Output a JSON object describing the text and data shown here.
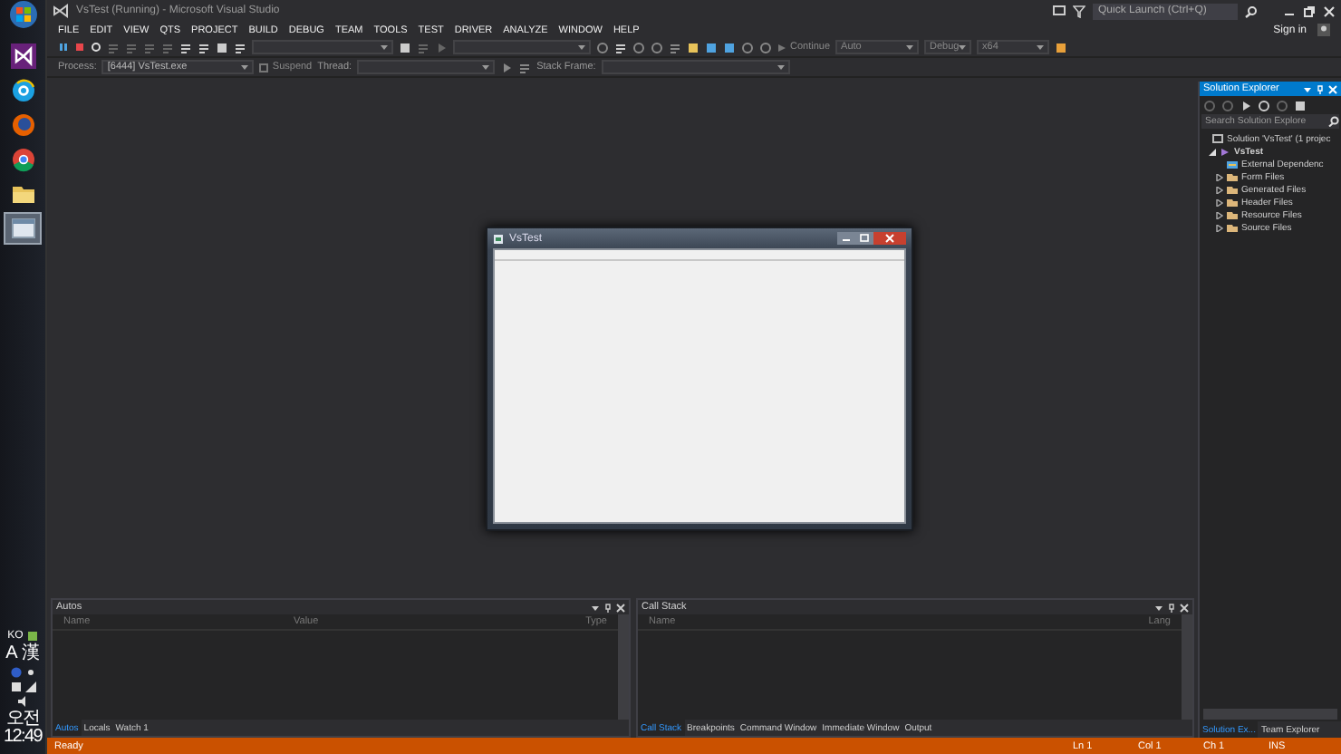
{
  "window": {
    "title": "VsTest (Running) - Microsoft Visual Studio",
    "quick_launch": {
      "placeholder": "Quick Launch (Ctrl+Q)"
    },
    "sign_in": "Sign in"
  },
  "menu": [
    "FILE",
    "EDIT",
    "VIEW",
    "QTS",
    "PROJECT",
    "BUILD",
    "DEBUG",
    "TEAM",
    "TOOLS",
    "TEST",
    "DRIVER",
    "ANALYZE",
    "WINDOW",
    "HELP"
  ],
  "toolbar": {
    "continue": "Continue",
    "dropdowns": [
      "Auto",
      "Debug",
      "x64"
    ]
  },
  "debug_location": {
    "process_label": "Process:",
    "process": "[6444] VsTest.exe",
    "suspend": "Suspend",
    "thread_label": "Thread:",
    "stack_frame_label": "Stack Frame:"
  },
  "taskbar": {
    "apps": [
      {
        "kind": "vs",
        "selected": false
      },
      {
        "kind": "ie",
        "selected": false
      },
      {
        "kind": "firefox",
        "selected": false
      },
      {
        "kind": "chrome",
        "selected": false
      },
      {
        "kind": "folder",
        "selected": false
      },
      {
        "kind": "app",
        "selected": true
      }
    ],
    "tray": [
      "KO",
      "A",
      "漢"
    ],
    "clock": "오전 12:49"
  },
  "app_window": {
    "title": "VsTest"
  },
  "solution_explorer": {
    "title": "Solution Explorer",
    "search": {
      "placeholder": "Search Solution Explore"
    },
    "tree": [
      {
        "label": "Solution 'VsTest' (1 projec",
        "kind": "solution",
        "children": [
          {
            "label": "VsTest",
            "kind": "project",
            "expanded": true,
            "children": [
              {
                "label": "External Dependenc",
                "kind": "references"
              },
              {
                "label": "Form Files",
                "kind": "folder",
                "expanded": false
              },
              {
                "label": "Generated Files",
                "kind": "folder",
                "expanded": false
              },
              {
                "label": "Header Files",
                "kind": "folder",
                "expanded": false
              },
              {
                "label": "Resource Files",
                "kind": "folder",
                "expanded": false
              },
              {
                "label": "Source Files",
                "kind": "folder",
                "expanded": false
              }
            ]
          }
        ]
      }
    ],
    "tabs": [
      {
        "label": "Solution Ex...",
        "selected": true
      },
      {
        "label": "Team Explorer",
        "selected": false
      }
    ]
  },
  "autos": {
    "title": "Autos",
    "columns": [
      "Name",
      "Value",
      "Type"
    ],
    "tabs": [
      {
        "label": "Autos",
        "selected": true
      },
      {
        "label": "Locals",
        "selected": false
      },
      {
        "label": "Watch 1",
        "selected": false
      }
    ]
  },
  "call_stack": {
    "title": "Call Stack",
    "columns": [
      "Name",
      "Lang"
    ],
    "tabs": [
      {
        "label": "Call Stack",
        "selected": true
      },
      {
        "label": "Breakpoints",
        "selected": false
      },
      {
        "label": "Command Window",
        "selected": false
      },
      {
        "label": "Immediate Window",
        "selected": false
      },
      {
        "label": "Output",
        "selected": false
      }
    ]
  },
  "status_bar": {
    "message": "Ready",
    "fields": [
      "Ln 1",
      "Col 1",
      "Ch 1",
      "INS"
    ]
  }
}
